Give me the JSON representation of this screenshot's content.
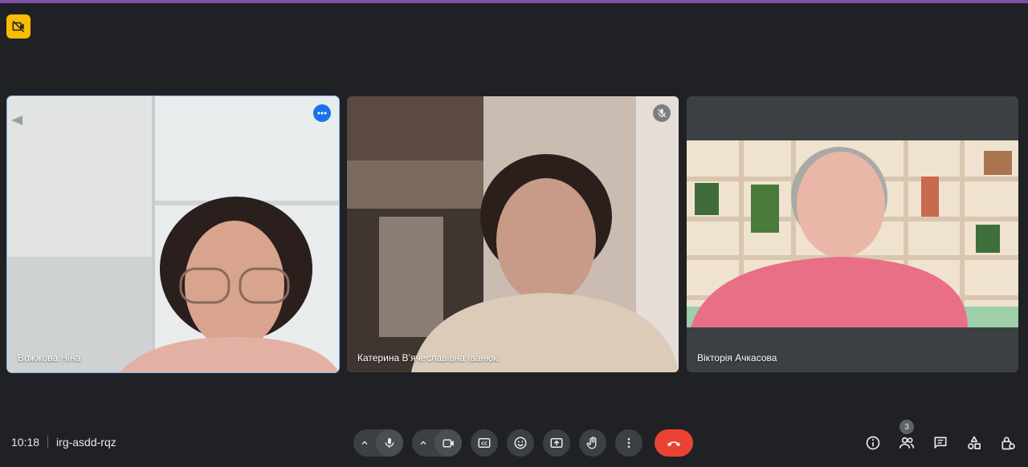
{
  "meeting": {
    "time": "10:18",
    "code": "irg-asdd-rqz"
  },
  "participants": [
    {
      "name": "Вожжова Ніна",
      "active": true
    },
    {
      "name": "Катерина В’ячеславівна Іванюк",
      "muted": true
    },
    {
      "name": "Вікторія Ачкасова"
    }
  ],
  "participant_count": "3",
  "icons": {
    "recording": "recording-off-icon",
    "more": "more-horiz-icon",
    "mic_off": "mic-off-icon",
    "controls": [
      "chevron-up-icon",
      "mic-icon",
      "chevron-up-icon",
      "videocam-icon",
      "captions-icon",
      "emoji-icon",
      "present-icon",
      "raise-hand-icon",
      "more-vert-icon",
      "call-end-icon"
    ],
    "right": [
      "info-icon",
      "people-icon",
      "chat-icon",
      "activities-icon",
      "host-controls-icon"
    ]
  },
  "colors": {
    "background": "#202124",
    "accent": "#7e4fa3",
    "active_outline": "#8ab4f8",
    "end_call": "#ea4335",
    "recording_badge": "#fbbc04"
  }
}
